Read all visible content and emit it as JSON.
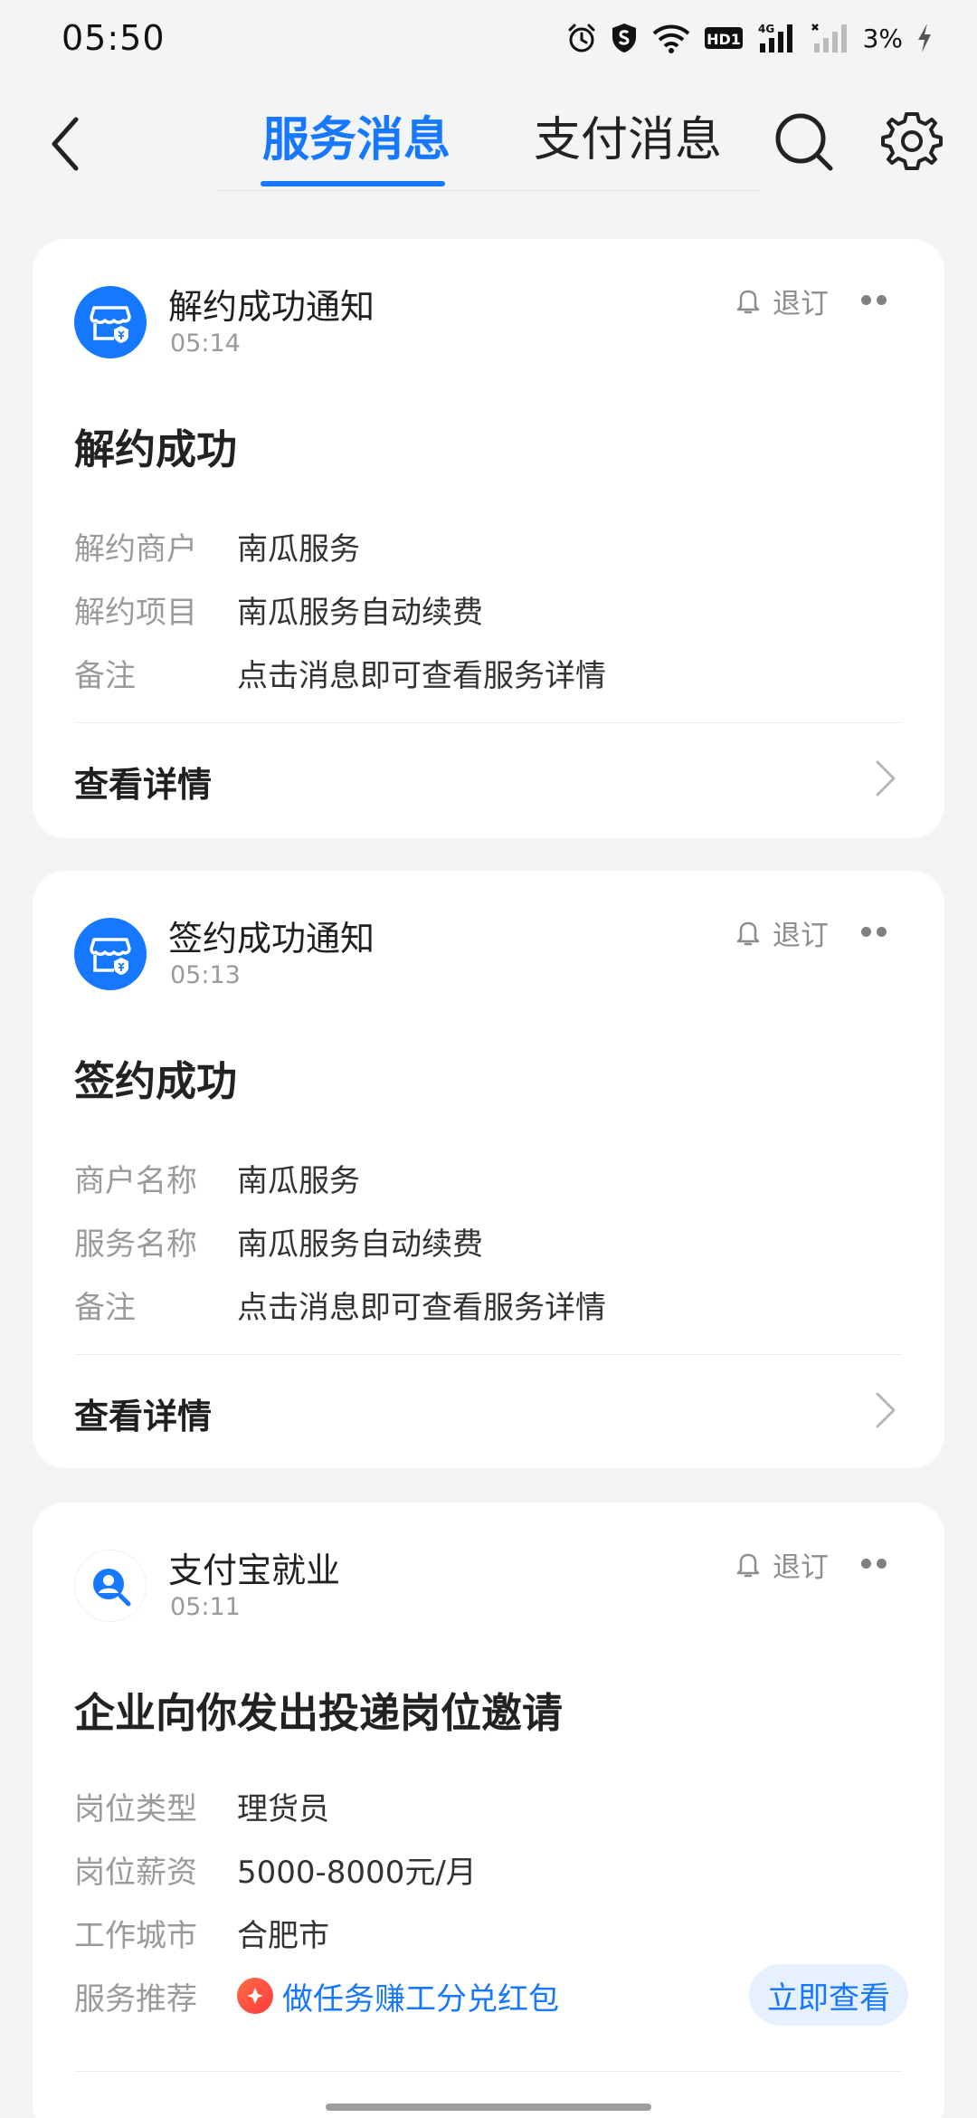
{
  "status_bar": {
    "time": "05:50",
    "battery": "3%",
    "icons": [
      "alarm-icon",
      "shield-s-icon",
      "wifi-icon",
      "hd-icon",
      "signal-4g-icon",
      "signal-no-sim-icon",
      "charging-icon"
    ],
    "network_label": "4G",
    "hd_label": "HD1"
  },
  "header": {
    "tabs": [
      {
        "label": "服务消息",
        "active": true
      },
      {
        "label": "支付消息",
        "active": false
      }
    ],
    "accent_color": "#1677ff"
  },
  "cards": [
    {
      "sender": "解约成功通知",
      "time": "05:14",
      "unsubscribe": "退订",
      "title": "解约成功",
      "rows": [
        {
          "label": "解约商户",
          "value": "南瓜服务"
        },
        {
          "label": "解约项目",
          "value": "南瓜服务自动续费"
        },
        {
          "label": "备注",
          "value": "点击消息即可查看服务详情"
        }
      ],
      "action": "查看详情"
    },
    {
      "sender": "签约成功通知",
      "time": "05:13",
      "unsubscribe": "退订",
      "title": "签约成功",
      "rows": [
        {
          "label": "商户名称",
          "value": "南瓜服务"
        },
        {
          "label": "服务名称",
          "value": "南瓜服务自动续费"
        },
        {
          "label": "备注",
          "value": "点击消息即可查看服务详情"
        }
      ],
      "action": "查看详情"
    },
    {
      "sender": "支付宝就业",
      "time": "05:11",
      "unsubscribe": "退订",
      "title": "企业向你发出投递岗位邀请",
      "rows": [
        {
          "label": "岗位类型",
          "value": "理货员"
        },
        {
          "label": "岗位薪资",
          "value": "5000-8000元/月"
        },
        {
          "label": "工作城市",
          "value": "合肥市"
        },
        {
          "label": "服务推荐",
          "value": "做任务赚工分兑红包"
        }
      ],
      "cta": "立即查看"
    }
  ]
}
